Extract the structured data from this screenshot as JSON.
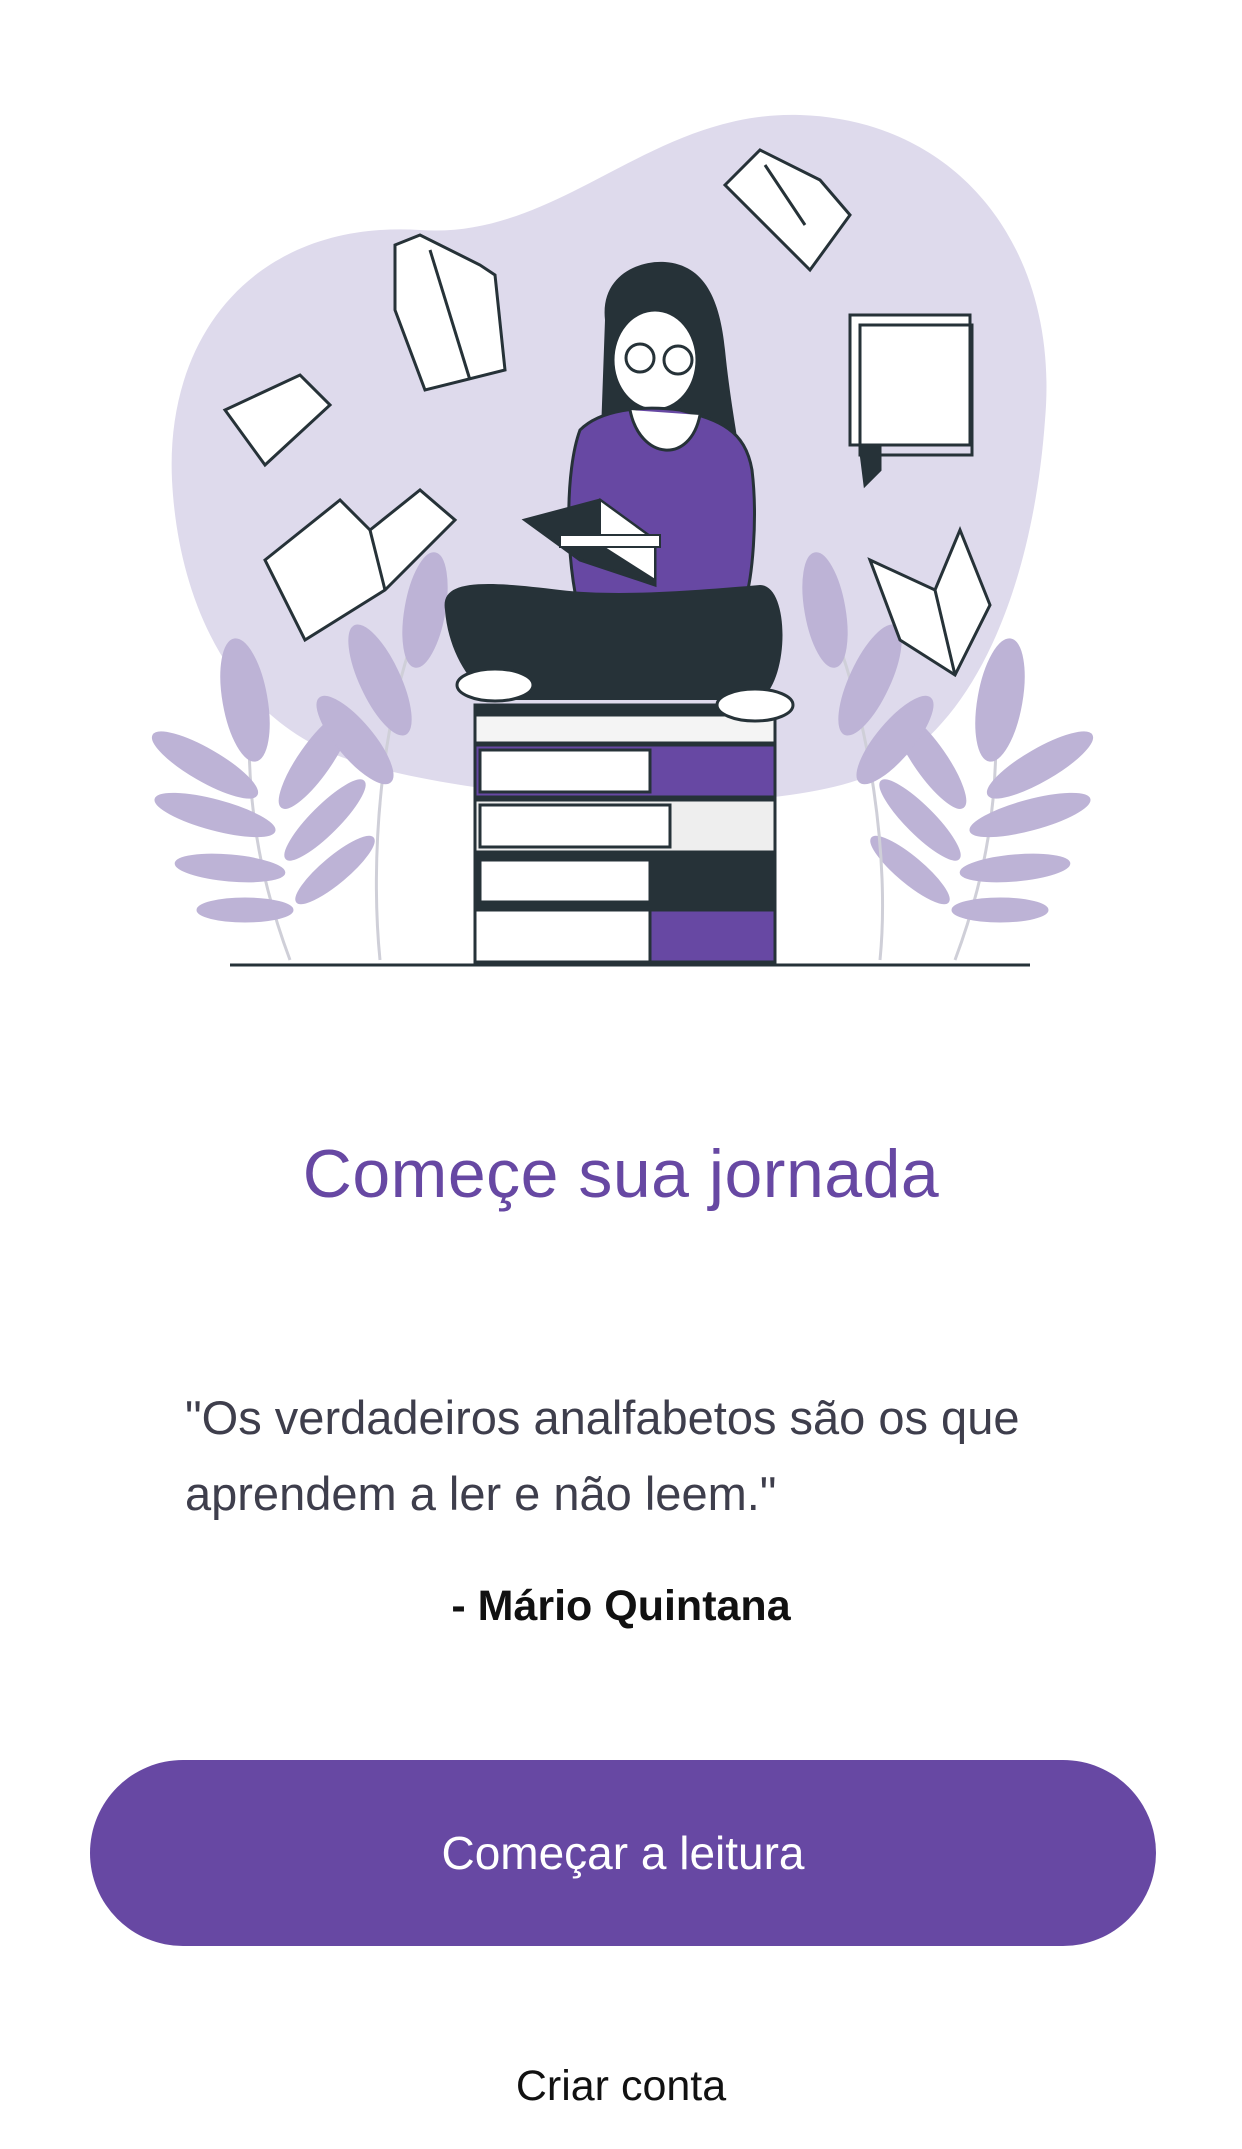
{
  "onboarding": {
    "title": "Começe sua jornada",
    "quote": "\"Os verdadeiros analfabetos são os que aprendem a ler e não leem.\"",
    "author": "- Mário Quintana",
    "primary_button_label": "Começar a leitura",
    "secondary_link_label": "Criar conta"
  },
  "colors": {
    "accent": "#6748A3",
    "accent_light": "#DEDAEC",
    "leaf": "#BDB3D6",
    "ink": "#263238"
  },
  "illustration": {
    "subject": "woman-reading-on-book-stack-illustration"
  }
}
